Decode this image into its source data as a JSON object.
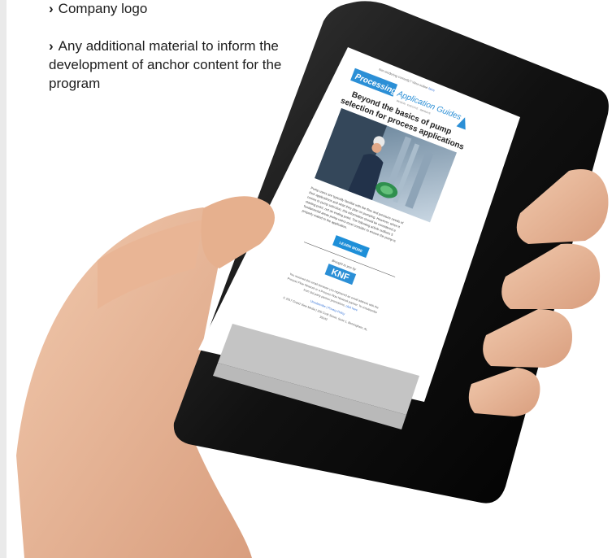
{
  "bullets": [
    {
      "text": "Company logo"
    },
    {
      "text": "Any additional material to inform the development of anchor content for the program"
    }
  ],
  "email": {
    "header_line": "Not rendering correctly? View online",
    "header_link": "here",
    "logo_processing": "Processing",
    "logo_guides": "Application Guides",
    "logo_tagline": "DESIGN · EXECUTE · IMPROVE",
    "headline_line1": "Beyond the basics of pump",
    "headline_line2": "selection for process applications",
    "body_lines": [
      "Pump users are typically familiar with the flow and pressure needs of",
      "their applications and what they plan on pumping. However, when it",
      "comes to pump selection, this information should be considered a",
      "starting point, not an ending point. The following article outlines 5",
      "fundamental areas pump users must consider to ensure the pump is",
      "properly mated to the application."
    ],
    "cta_label": "LEARN MORE",
    "brought_by": "Brought to you by",
    "sponsor_logo": "KNF",
    "footer_lines": [
      "You received this email because you registered an email address with the",
      "Process Flow Network or a Process Flow Network partner. To unsubscribe",
      "from 3rd party partner promotions,"
    ],
    "footer_link_click": "click here",
    "unsubscribe_label": "Unsubscribe",
    "privacy_label": "Privacy Policy",
    "copyright_line1": "© 2017 Grand View Media | 200 Croft Street, Suite 1, Birmingham, AL",
    "copyright_line2": "35242"
  },
  "colors": {
    "accent_blue": "#2b8fd6",
    "cta_blue": "#1e8fd8",
    "footer_gray": "#b9b9b9",
    "phone_body": "#111111",
    "skin": "#e8b796"
  }
}
